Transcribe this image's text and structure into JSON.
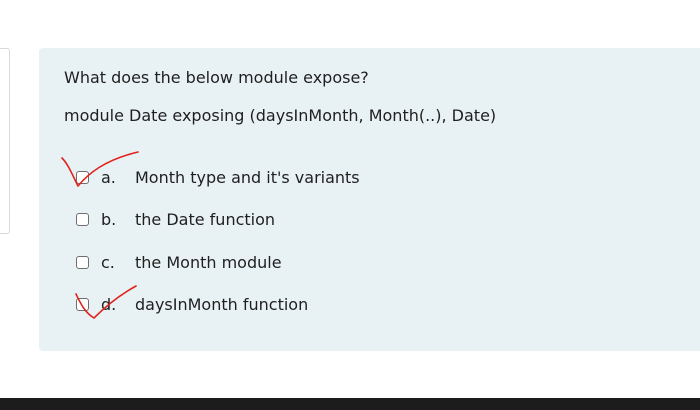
{
  "question": {
    "title": "What does the below module expose?",
    "code": "module Date exposing (daysInMonth, Month(..), Date)"
  },
  "answers": [
    {
      "letter": "a.",
      "label": "Month type and it's variants",
      "checked": false,
      "marked": true
    },
    {
      "letter": "b.",
      "label": "the Date function",
      "checked": false,
      "marked": false
    },
    {
      "letter": "c.",
      "label": "the Month module",
      "checked": false,
      "marked": false
    },
    {
      "letter": "d.",
      "label": "daysInMonth function",
      "checked": false,
      "marked": true
    }
  ],
  "colors": {
    "card_background": "#e8f2f5",
    "tick_mark": "#e0231c",
    "text": "#1f1f1f",
    "bottom_bar": "#1c1c1c"
  }
}
